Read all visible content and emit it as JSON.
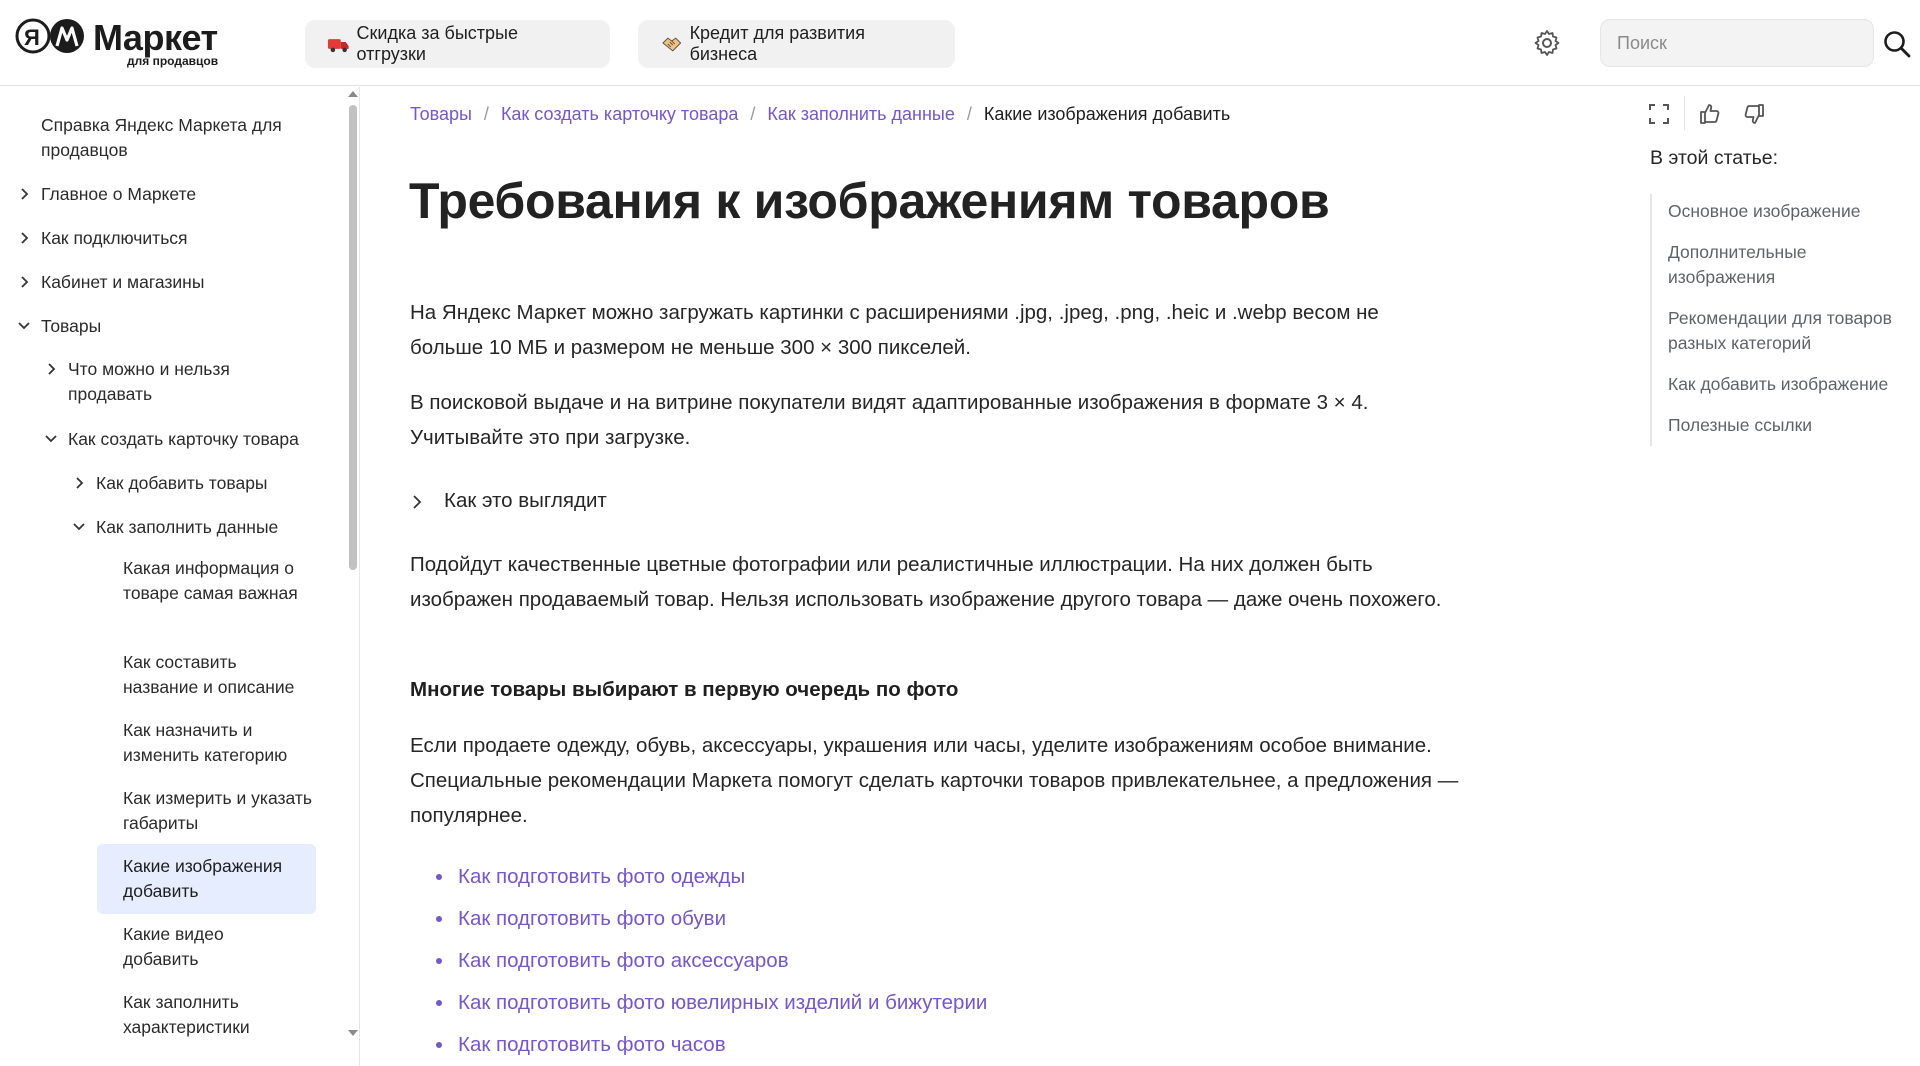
{
  "header": {
    "logo_word": "Маркет",
    "logo_sub": "для продавцов",
    "promo_1": "Скидка за быстрые отгрузки",
    "promo_2": "Кредит для развития бизнеса",
    "search_placeholder": "Поиск"
  },
  "sidebar": {
    "items": [
      {
        "label": "Справка Яндекс Маркета для продавцов"
      },
      {
        "label": "Главное о Маркете"
      },
      {
        "label": "Как подключиться"
      },
      {
        "label": "Кабинет и магазины"
      },
      {
        "label": "Товары"
      },
      {
        "label": "Что можно и нельзя продавать"
      },
      {
        "label": "Как создать карточку товара"
      },
      {
        "label": "Как добавить товары"
      },
      {
        "label": "Как заполнить данные"
      },
      {
        "label": "Какая информация о товаре самая важная"
      },
      {
        "label": "Как составить название и описание"
      },
      {
        "label": "Как назначить и изменить категорию"
      },
      {
        "label": "Как измерить и указать габариты"
      },
      {
        "label": "Какие изображения добавить"
      },
      {
        "label": "Какие видео добавить"
      },
      {
        "label": "Как заполнить характеристики"
      }
    ]
  },
  "breadcrumb": {
    "items": [
      "Товары",
      "Как создать карточку товара",
      "Как заполнить данные"
    ],
    "current": "Какие изображения добавить"
  },
  "main": {
    "title": "Требования к изображениям товаров",
    "p1": "На Яндекс Маркет можно загружать картинки с расширениями .jpg, .jpeg, .png, .heic и .webp весом не больше 10 МБ и размером не меньше 300 × 300 пикселей.",
    "p2": "В поисковой выдаче и на витрине покупатели видят адаптированные изображения в формате 3 × 4. Учитывайте это при загрузке.",
    "expand_label": "Как это выглядит",
    "p3": "Подойдут качественные цветные фотографии или реалистичные иллюстрации. На них должен быть изображен продаваемый товар. Нельзя использовать изображение другого товара — даже очень похожего.",
    "bold_heading": "Многие товары выбирают в первую очередь по фото",
    "p4": "Если продаете одежду, обувь, аксессуары, украшения или часы, уделите изображениям особое внимание. Специальные рекомендации Маркета помогут сделать карточки товаров привлекательнее, а предложения — популярнее.",
    "links": [
      "Как подготовить фото одежды",
      "Как подготовить фото обуви",
      "Как подготовить фото аксессуаров",
      "Как подготовить фото ювелирных изделий и бижутерии",
      "Как подготовить фото часов"
    ]
  },
  "toc": {
    "title": "В этой статье:",
    "items": [
      "Основное изображение",
      "Дополнительные изображения",
      "Рекомендации для товаров разных категорий",
      "Как добавить изображение",
      "Полезные ссылки"
    ]
  },
  "colors": {
    "link": "#7755cc",
    "active_bg": "#e6edff",
    "text": "#262626"
  }
}
